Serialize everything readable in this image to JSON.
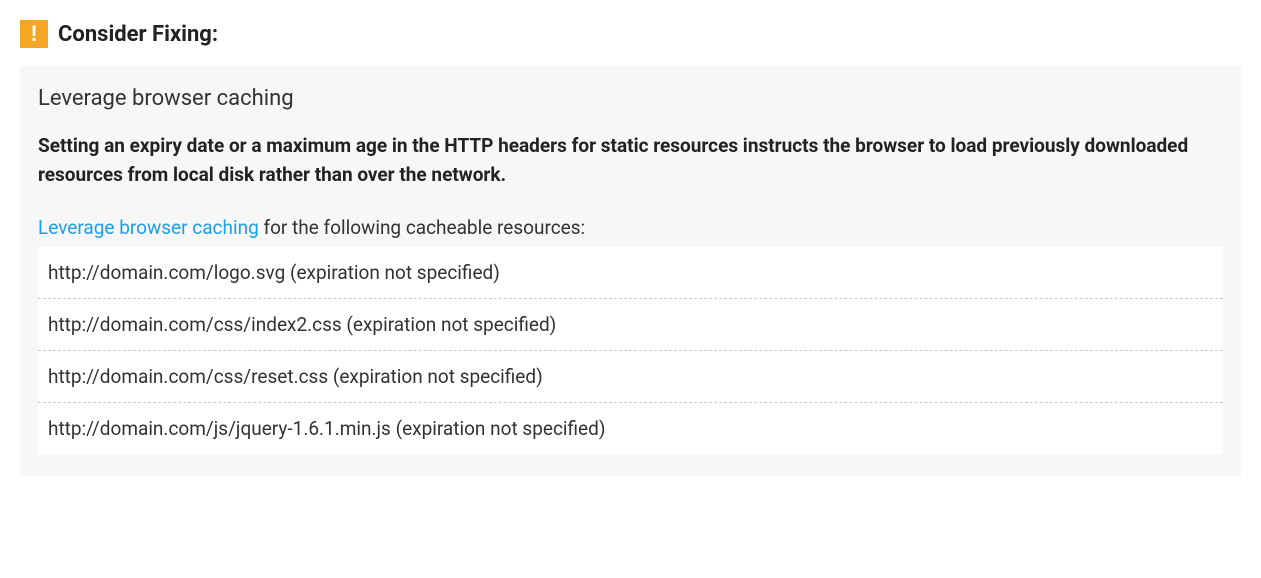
{
  "header": {
    "badge_glyph": "!",
    "title": "Consider Fixing:"
  },
  "panel": {
    "title": "Leverage browser caching",
    "description": "Setting an expiry date or a maximum age in the HTTP headers for static resources instructs the browser to load previously downloaded resources from local disk rather than over the network.",
    "hint_link_text": "Leverage browser caching",
    "hint_suffix": " for the following cacheable resources:",
    "resources": [
      "http://domain.com/logo.svg (expiration not specified)",
      "http://domain.com/css/index2.css (expiration not specified)",
      "http://domain.com/css/reset.css (expiration not specified)",
      "http://domain.com/js/jquery-1.6.1.min.js (expiration not specified)"
    ]
  }
}
